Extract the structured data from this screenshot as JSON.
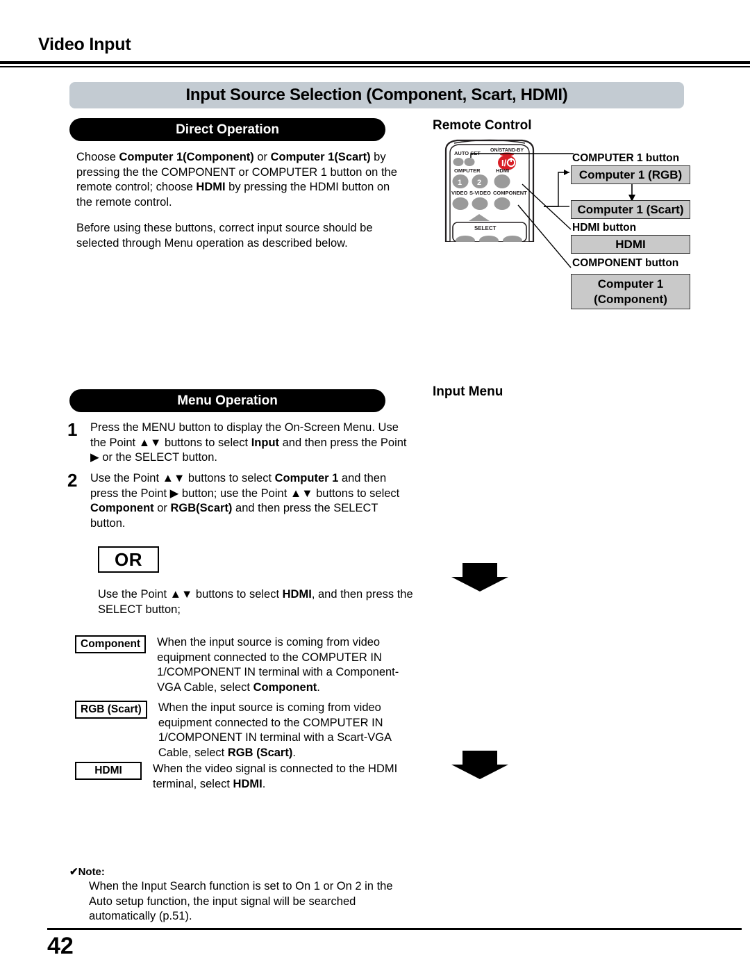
{
  "running_head": "Video Input",
  "section_banner": "Input Source Selection (Component, Scart, HDMI)",
  "direct_operation": {
    "pill_label": "Direct Operation",
    "paragraph_1": "Choose <b>Computer 1(Component)</b> or <b>Computer 1(Scart)</b> by pressing the the COMPONENT or COMPUTER 1 button on the remote control; choose <b>HDMI</b> by pressing the HDMI button on the remote control.",
    "paragraph_2": "Before using these buttons, correct input source should be selected through Menu operation as described below."
  },
  "menu_operation": {
    "pill_label": "Menu Operation",
    "steps": [
      {
        "number": "1",
        "text": "Press the MENU button to display the On-Screen Menu. Use the Point ▲▼ buttons to select <b>Input</b> and then press the Point ▶ or the SELECT button."
      },
      {
        "number": "2",
        "text": "Use the Point ▲▼ buttons to select <b>Computer 1</b> and then press the Point ▶ button; use the Point ▲▼ buttons to select <b>Component</b> or <b>RGB(Scart)</b> and then press the SELECT button."
      }
    ],
    "or_label": "OR",
    "or_text": "Use the Point ▲▼ buttons to select <b>HDMI</b>, and then press the SELECT button;"
  },
  "definitions": [
    {
      "tag": "Component",
      "text": "When the input source is coming from video equipment connected to the COMPUTER IN 1/COMPONENT IN terminal with a Component-VGA Cable, select <b>Component</b>."
    },
    {
      "tag": "RGB (Scart)",
      "text": "When the input source is coming from video equipment connected to the COMPUTER IN 1/COMPONENT IN terminal with a Scart-VGA Cable, select <b>RGB (Scart)</b>."
    },
    {
      "tag": "HDMI",
      "text": "When the video signal is connected to the HDMI terminal, select <b>HDMI</b>."
    }
  ],
  "note": {
    "title": "✔Note:",
    "body": "When the Input Search function is set to On 1 or On 2 in the Auto setup function, the input signal will be searched automatically (p.51)."
  },
  "right_column": {
    "remote_control_label": "Remote Control",
    "input_menu_label": "Input Menu",
    "callouts": [
      {
        "label": "COMPUTER 1 button"
      },
      {
        "label": "HDMI button"
      },
      {
        "label": "COMPONENT button"
      }
    ],
    "boxes": {
      "computer1_rgb": "Computer 1 (RGB)",
      "computer1_scart": "Computer 1 (Scart)",
      "hdmi": "HDMI",
      "computer1_component_line1": "Computer 1",
      "computer1_component_line2": "(Component)"
    }
  },
  "remote": {
    "auto_set_label": "AUTO SET",
    "on_standby_label": "ON/STAND-BY",
    "power_symbol": "I/⏻",
    "computer_label": "OMPUTER",
    "hdmi_label": "HDMI",
    "button_1": "1",
    "button_2": "2",
    "video_label": "VIDEO",
    "svideo_label": "S-VIDEO",
    "component_label": "COMPONENT",
    "select_label": "SELECT"
  },
  "footer": {
    "page_number": "42"
  },
  "colors": {
    "banner": "#c3cbd2",
    "pill": "#000000",
    "gray_box": "#c9c9c9",
    "power_button": "#d81f26",
    "remote_button": "#9a9a9a"
  }
}
